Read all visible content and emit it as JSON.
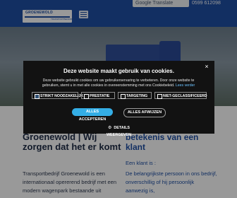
{
  "header": {
    "logo_text": "GROENEWOLD",
    "logo_subtext": "TRANSPORTBEDRIJF",
    "translate_label": "Google Translate",
    "phone": "0599 612098"
  },
  "content": {
    "left_title": "Groenewold | Wij zorgen dat het er komt",
    "left_text": "Transportbedrijf Groenewold is een internationaal opererend bedrijf met een modern wagenpark bestaande uit",
    "right_title": "betekenis van een klant",
    "right_label": "Een klant is :",
    "right_text": "De belangrijkste persoon in ons bedrijf, onverschillig of hij persoonlijk aanwezig is,"
  },
  "cookie_modal": {
    "title": "Deze website maakt gebruik van cookies.",
    "description": "Deze website gebruikt cookies om uw gebruikerservaring te verbeteren. Door onze website te gebruiken, stemt u in met alle cookies in overeenstemming met ons Cookiebeleid.",
    "read_more": "Lees verder",
    "options": [
      {
        "label": "STRIKT NOODZAKELIJK",
        "checked": true
      },
      {
        "label": "PRESTATIE",
        "checked": false
      },
      {
        "label": "TARGETING",
        "checked": false
      },
      {
        "label": "NIET-GECLASSIFICEERD",
        "checked": false
      }
    ],
    "accept_label": "ALLES ACCEPTEREN",
    "reject_label": "ALLES AFWIJZEN",
    "details_label": "DETAILS",
    "details_sub": "WEERGEVEN",
    "close_symbol": "×"
  },
  "colors": {
    "brand_blue": "#1f4fa3",
    "modal_bg": "#121212",
    "accept_blue": "#34aee6"
  }
}
